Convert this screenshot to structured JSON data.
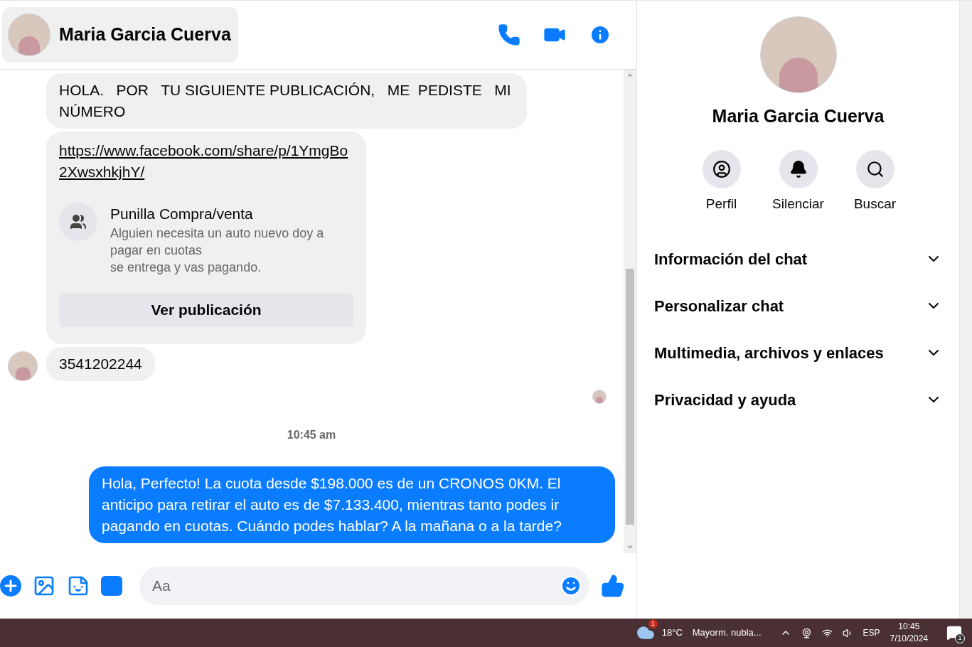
{
  "header": {
    "name": "Maria Garcia Cuerva"
  },
  "messages": [
    {
      "kind": "text",
      "outgoing": false,
      "text": "HOLA.   POR   TU SIGUIENTE PUBLICACIÓN,   ME  PEDISTE   MI NÚMERO",
      "avatar": false
    },
    {
      "kind": "share",
      "link": "https://www.facebook.com/share/p/1YmgBo2XwsxhkjhY/",
      "group": "Punilla Compra/venta",
      "desc": "Alguien necesita un auto nuevo doy a pagar en cuotas\nse entrega y vas pagando.",
      "button": "Ver publicación"
    },
    {
      "kind": "text",
      "outgoing": false,
      "text": "3541202244",
      "avatar": true
    },
    {
      "kind": "seen"
    },
    {
      "kind": "time",
      "text": "10:45 am"
    },
    {
      "kind": "text",
      "outgoing": true,
      "text": "Hola, Perfecto! La cuota desde $198.000 es de un CRONOS 0KM. El anticipo para retirar el auto es de $7.133.400, mientras tanto podes ir pagando en cuotas. Cuándo podes hablar? A la mañana o a la tarde?"
    }
  ],
  "composer": {
    "placeholder": "Aa"
  },
  "profile": {
    "name": "Maria Garcia Cuerva",
    "actions": [
      {
        "kind": "profile",
        "label": "Perfil"
      },
      {
        "kind": "mute",
        "label": "Silenciar"
      },
      {
        "kind": "search",
        "label": "Buscar"
      }
    ],
    "sections": [
      {
        "label": "Información del chat",
        "expanded": false
      },
      {
        "label": "Personalizar chat",
        "expanded": false
      },
      {
        "label": "Multimedia, archivos y enlaces",
        "expanded": false
      },
      {
        "label": "Privacidad y ayuda",
        "expanded": false
      }
    ]
  },
  "taskbar": {
    "weather_badge": "1",
    "temperature": "18°C",
    "weather": "Mayorm. nubla...",
    "language": "ESP",
    "time": "10:45",
    "date": "7/10/2024",
    "notifications": "1"
  }
}
